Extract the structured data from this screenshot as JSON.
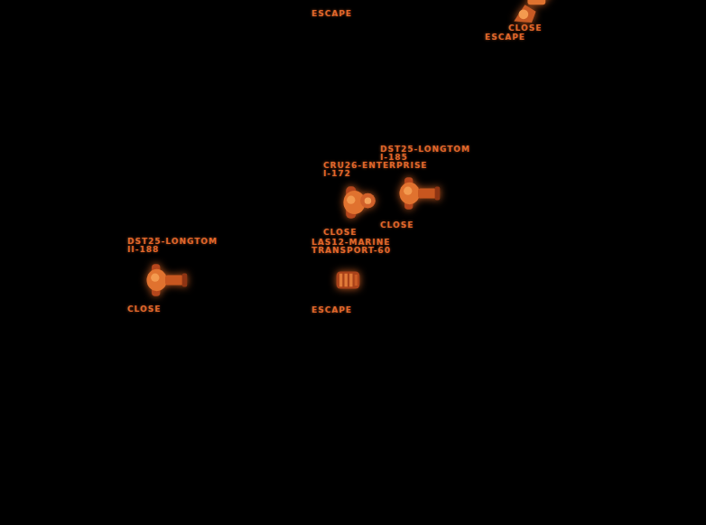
{
  "units": [
    {
      "name": "",
      "id": "",
      "order": "ESCAPE"
    },
    {
      "name": "",
      "id": "",
      "order": "CLOSE"
    },
    {
      "name": "",
      "id": "",
      "order": "ESCAPE"
    },
    {
      "name": "CRU26-ENTERPRISE",
      "id": "I-172",
      "order": "CLOSE"
    },
    {
      "name": "DST25-LONGTOM",
      "id": "I-185",
      "order": "CLOSE"
    },
    {
      "name": "DST25-LONGTOM",
      "id": "II-188",
      "order": "CLOSE"
    },
    {
      "name": "LAS12-MARINE",
      "id": "TRANSPORT-60",
      "order": "ESCAPE"
    }
  ]
}
